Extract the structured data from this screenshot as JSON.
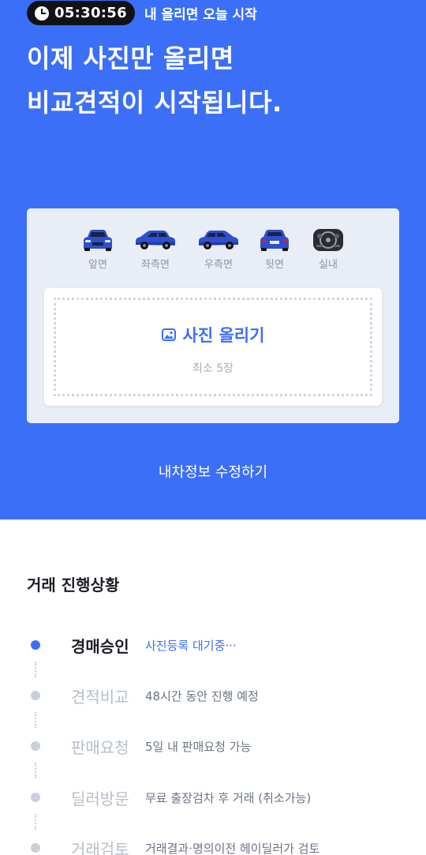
{
  "timer": {
    "time": "05:30:56",
    "note": "내 올리면 오늘 시작"
  },
  "headline": {
    "line1": "이제 사진만 올리면",
    "line2": "비교견적이 시작됩니다."
  },
  "angles": [
    {
      "label": "앞면",
      "icon": "car-front-icon"
    },
    {
      "label": "좌측면",
      "icon": "car-left-side-icon"
    },
    {
      "label": "우측면",
      "icon": "car-right-side-icon"
    },
    {
      "label": "뒷면",
      "icon": "car-rear-icon"
    },
    {
      "label": "실내",
      "icon": "car-interior-icon"
    }
  ],
  "upload": {
    "button_label": "사진 올리기",
    "subtitle": "최소 5장",
    "icon": "image-icon"
  },
  "edit_link": "내차정보 수정하기",
  "progress": {
    "title": "거래 진행상황",
    "steps": [
      {
        "name": "경매승인",
        "desc": "사진등록 대기중···",
        "active": true
      },
      {
        "name": "견적비교",
        "desc": "48시간 동안 진행 예정",
        "active": false
      },
      {
        "name": "판매요청",
        "desc": "5일 내 판매요청 가능",
        "active": false
      },
      {
        "name": "딜러방문",
        "desc": "무료 출장검차 후 거래 (취소가능)",
        "active": false
      },
      {
        "name": "거래검토",
        "desc": "거래결과·명의이전 헤이딜러가 검토",
        "active": false
      }
    ]
  },
  "colors": {
    "brand": "#3c6ff7",
    "dark": "#111216",
    "card": "#e9eef6"
  }
}
